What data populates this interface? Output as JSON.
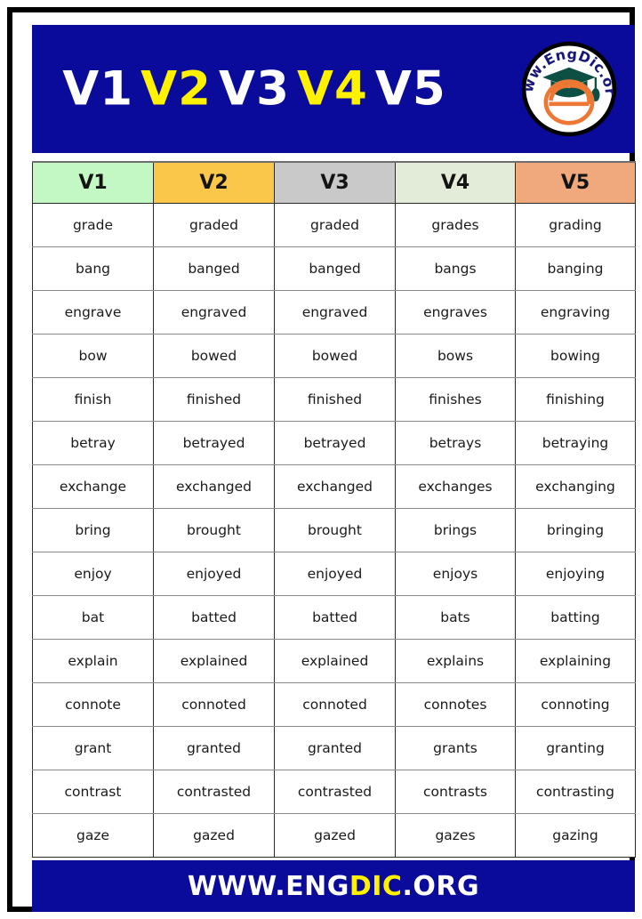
{
  "banner": {
    "title_parts": [
      {
        "text": "V1",
        "color": "#ffffff"
      },
      {
        "text": "V2",
        "color": "#fff200"
      },
      {
        "text": "V3",
        "color": "#ffffff"
      },
      {
        "text": "V4",
        "color": "#fff200"
      },
      {
        "text": "V5",
        "color": "#ffffff"
      }
    ],
    "background_color": "#0a0a9b",
    "logo": {
      "arc_text": "www.EngDic.org",
      "letter": "e",
      "arc_text_color": "#17177a",
      "cap_color": "#0d5043",
      "letter_color": "#ee7733",
      "ring_color": "#000000",
      "disc_color": "#ffffff"
    }
  },
  "table": {
    "headers": [
      {
        "label": "V1",
        "bg": "#c3f7c3"
      },
      {
        "label": "V2",
        "bg": "#fbc74b"
      },
      {
        "label": "V3",
        "bg": "#c9c9c9"
      },
      {
        "label": "V4",
        "bg": "#e2ecd9"
      },
      {
        "label": "V5",
        "bg": "#efa97c"
      }
    ],
    "rows": [
      [
        "grade",
        "graded",
        "graded",
        "grades",
        "grading"
      ],
      [
        "bang",
        "banged",
        "banged",
        "bangs",
        "banging"
      ],
      [
        "engrave",
        "engraved",
        "engraved",
        "engraves",
        "engraving"
      ],
      [
        "bow",
        "bowed",
        "bowed",
        "bows",
        "bowing"
      ],
      [
        "finish",
        "finished",
        "finished",
        "finishes",
        "finishing"
      ],
      [
        "betray",
        "betrayed",
        "betrayed",
        "betrays",
        "betraying"
      ],
      [
        "exchange",
        "exchanged",
        "exchanged",
        "exchanges",
        "exchanging"
      ],
      [
        "bring",
        "brought",
        "brought",
        "brings",
        "bringing"
      ],
      [
        "enjoy",
        "enjoyed",
        "enjoyed",
        "enjoys",
        "enjoying"
      ],
      [
        "bat",
        "batted",
        "batted",
        "bats",
        "batting"
      ],
      [
        "explain",
        "explained",
        "explained",
        "explains",
        "explaining"
      ],
      [
        "connote",
        "connoted",
        "connoted",
        "connotes",
        "connoting"
      ],
      [
        "grant",
        "granted",
        "granted",
        "grants",
        "granting"
      ],
      [
        "contrast",
        "contrasted",
        "contrasted",
        "contrasts",
        "contrasting"
      ],
      [
        "gaze",
        "gazed",
        "gazed",
        "gazes",
        "gazing"
      ]
    ]
  },
  "footer": {
    "parts": [
      {
        "text": "WWW.ENG",
        "color": "#ffffff"
      },
      {
        "text": "DIC",
        "color": "#fff200"
      },
      {
        "text": ".ORG",
        "color": "#ffffff"
      }
    ],
    "background_color": "#0a0a9b"
  }
}
